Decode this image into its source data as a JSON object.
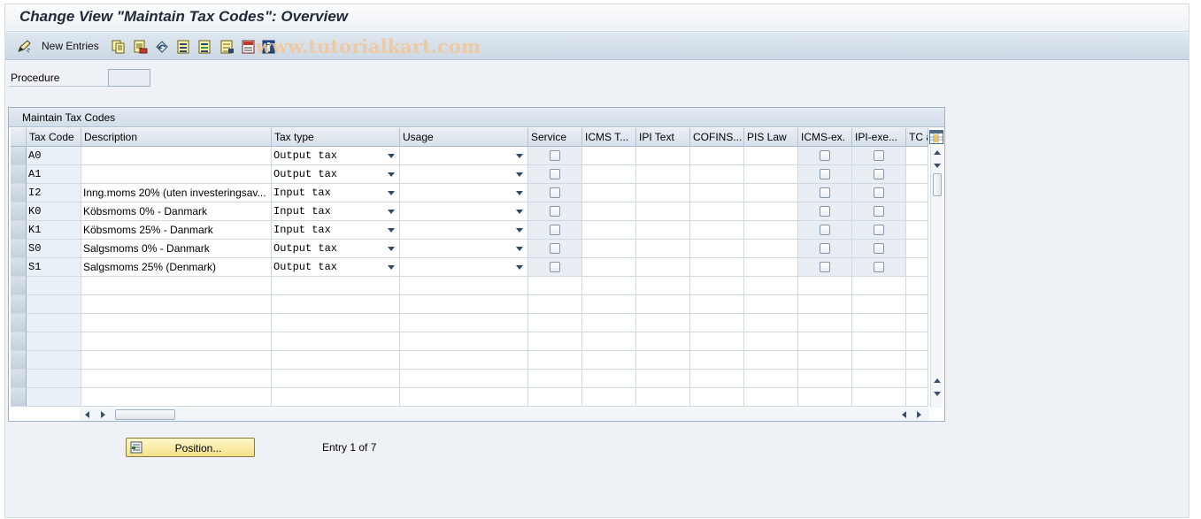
{
  "title": "Change View \"Maintain Tax Codes\": Overview",
  "toolbar": {
    "new_entries_label": "New Entries",
    "icons": [
      "edit-pencil-icon",
      "copy-icon",
      "delete-icon",
      "undo-icon",
      "select-all-icon",
      "select-block-icon",
      "deselect-all-icon",
      "print-icon",
      "info-icon"
    ]
  },
  "watermark": "www.tutorialkart.com",
  "procedure": {
    "label": "Procedure",
    "value": ""
  },
  "table": {
    "title": "Maintain Tax Codes",
    "headers": {
      "tax_code": "Tax Code",
      "description": "Description",
      "tax_type": "Tax type",
      "usage": "Usage",
      "service": "Service",
      "icms_t": "ICMS T...",
      "ipi_text": "IPI Text",
      "cofins": "COFINS...",
      "pis_law": "PIS Law",
      "icms_ex": "ICMS-ex.",
      "ipi_exe": "IPI-exe...",
      "tc": "TC a"
    },
    "rows": [
      {
        "tax_code": "A0",
        "description": "",
        "tax_type": "Output tax",
        "usage": "",
        "service": false,
        "icms_ex": false,
        "ipi_exe": false
      },
      {
        "tax_code": "A1",
        "description": "",
        "tax_type": "Output tax",
        "usage": "",
        "service": false,
        "icms_ex": false,
        "ipi_exe": false
      },
      {
        "tax_code": "I2",
        "description": "Inng.moms 20% (uten investeringsav...",
        "tax_type": "Input tax",
        "usage": "",
        "service": false,
        "icms_ex": false,
        "ipi_exe": false
      },
      {
        "tax_code": "K0",
        "description": "Köbsmoms 0%    -  Danmark",
        "tax_type": "Input tax",
        "usage": "",
        "service": false,
        "icms_ex": false,
        "ipi_exe": false
      },
      {
        "tax_code": "K1",
        "description": "Köbsmoms 25%   -  Danmark",
        "tax_type": "Input tax",
        "usage": "",
        "service": false,
        "icms_ex": false,
        "ipi_exe": false
      },
      {
        "tax_code": "S0",
        "description": "Salgsmoms 0%   -  Danmark",
        "tax_type": "Output tax",
        "usage": "",
        "service": false,
        "icms_ex": false,
        "ipi_exe": false
      },
      {
        "tax_code": "S1",
        "description": "Salgsmoms 25% (Denmark)",
        "tax_type": "Output tax",
        "usage": "",
        "service": false,
        "icms_ex": false,
        "ipi_exe": false
      }
    ],
    "empty_rows": 7
  },
  "position_button": "Position...",
  "entry_info": "Entry 1 of 7"
}
